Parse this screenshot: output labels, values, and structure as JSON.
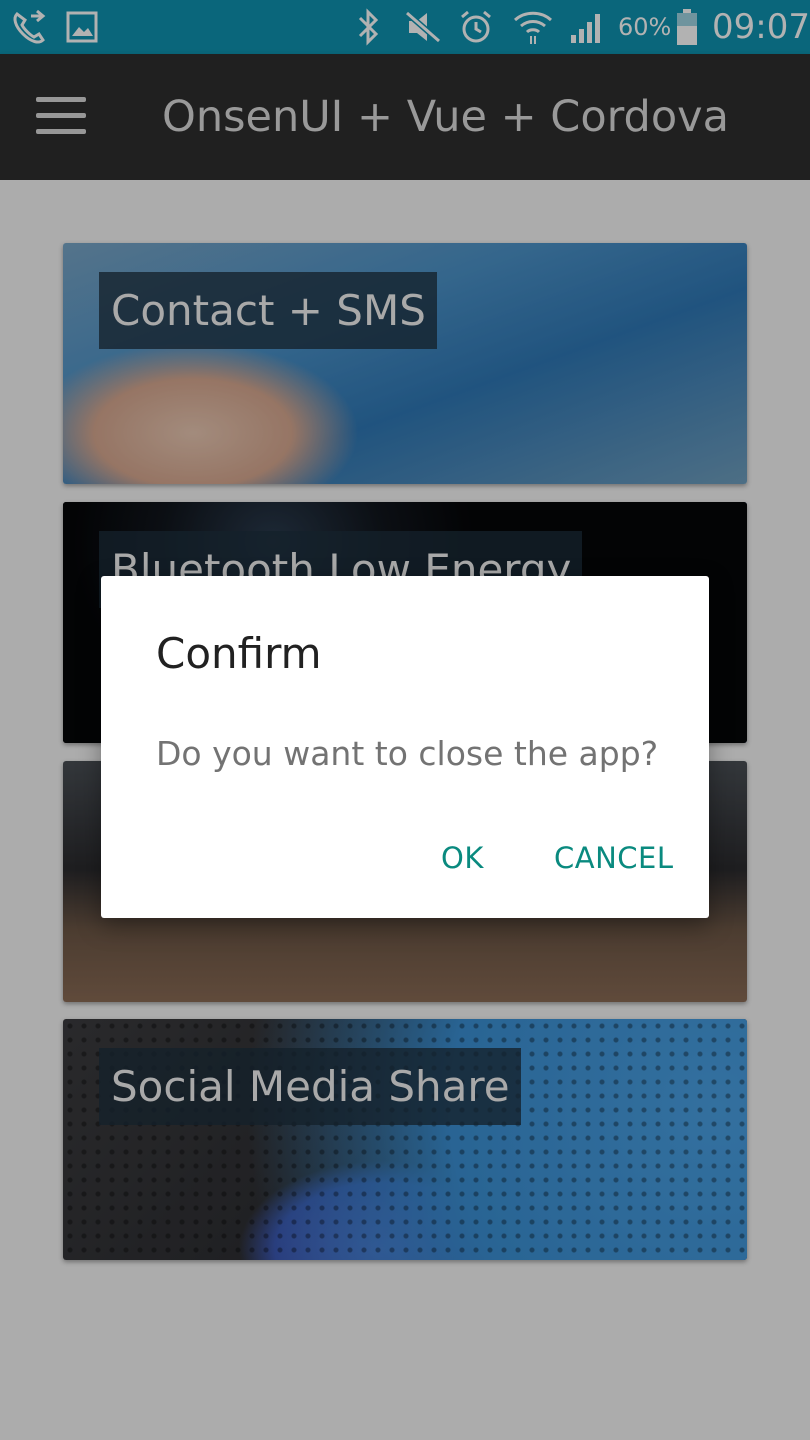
{
  "status_bar": {
    "icons": [
      "call-forward-icon",
      "image-icon",
      "bluetooth-icon",
      "mute-icon",
      "alarm-icon",
      "wifi-icon",
      "signal-icon",
      "battery-icon"
    ],
    "battery_percent": "60%",
    "time": "09:07",
    "color": "#0f93b0"
  },
  "toolbar": {
    "menu_icon": "hamburger-menu-icon",
    "title": "OnsenUI + Vue + Cordova",
    "color": "#2e2e2e"
  },
  "cards": [
    {
      "label": "Contact + SMS"
    },
    {
      "label": "Bluetooth Low Energy"
    },
    {
      "label": ""
    },
    {
      "label": "Social Media Share"
    }
  ],
  "dialog": {
    "title": "Confirm",
    "message": "Do you want to close the app?",
    "ok_label": "OK",
    "cancel_label": "CANCEL",
    "button_color": "#0a8a7f"
  }
}
